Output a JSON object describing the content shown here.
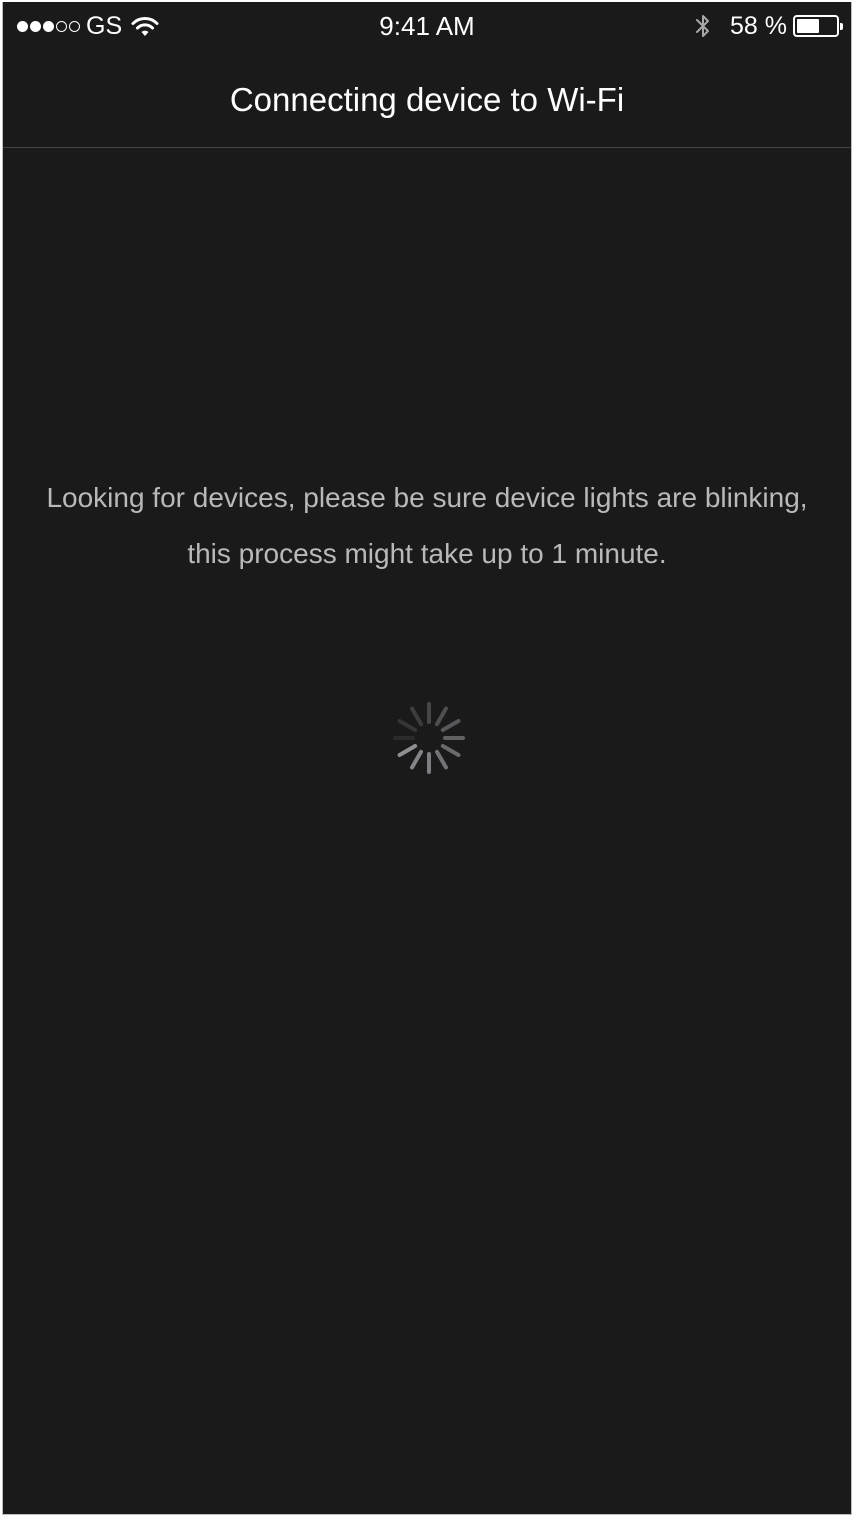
{
  "status_bar": {
    "signal_bars_filled": 3,
    "signal_bars_total": 5,
    "carrier": "GS",
    "time": "9:41 AM",
    "battery_percent": "58 %",
    "battery_level": 0.58,
    "icons": [
      "signal-dots-icon",
      "wifi-icon",
      "bluetooth-icon",
      "battery-icon"
    ]
  },
  "nav": {
    "title": "Connecting device to Wi-Fi"
  },
  "main": {
    "message_line_1": "Looking for devices, please be sure device lights are blinking,",
    "message_line_2": "this process might take up to 1 minute.",
    "spinner_icon": "activity-spinner-icon"
  },
  "colors": {
    "background": "#1a1a1b",
    "message_text": "#b9b9bb",
    "title_text": "#ffffff",
    "divider": "#444446"
  }
}
